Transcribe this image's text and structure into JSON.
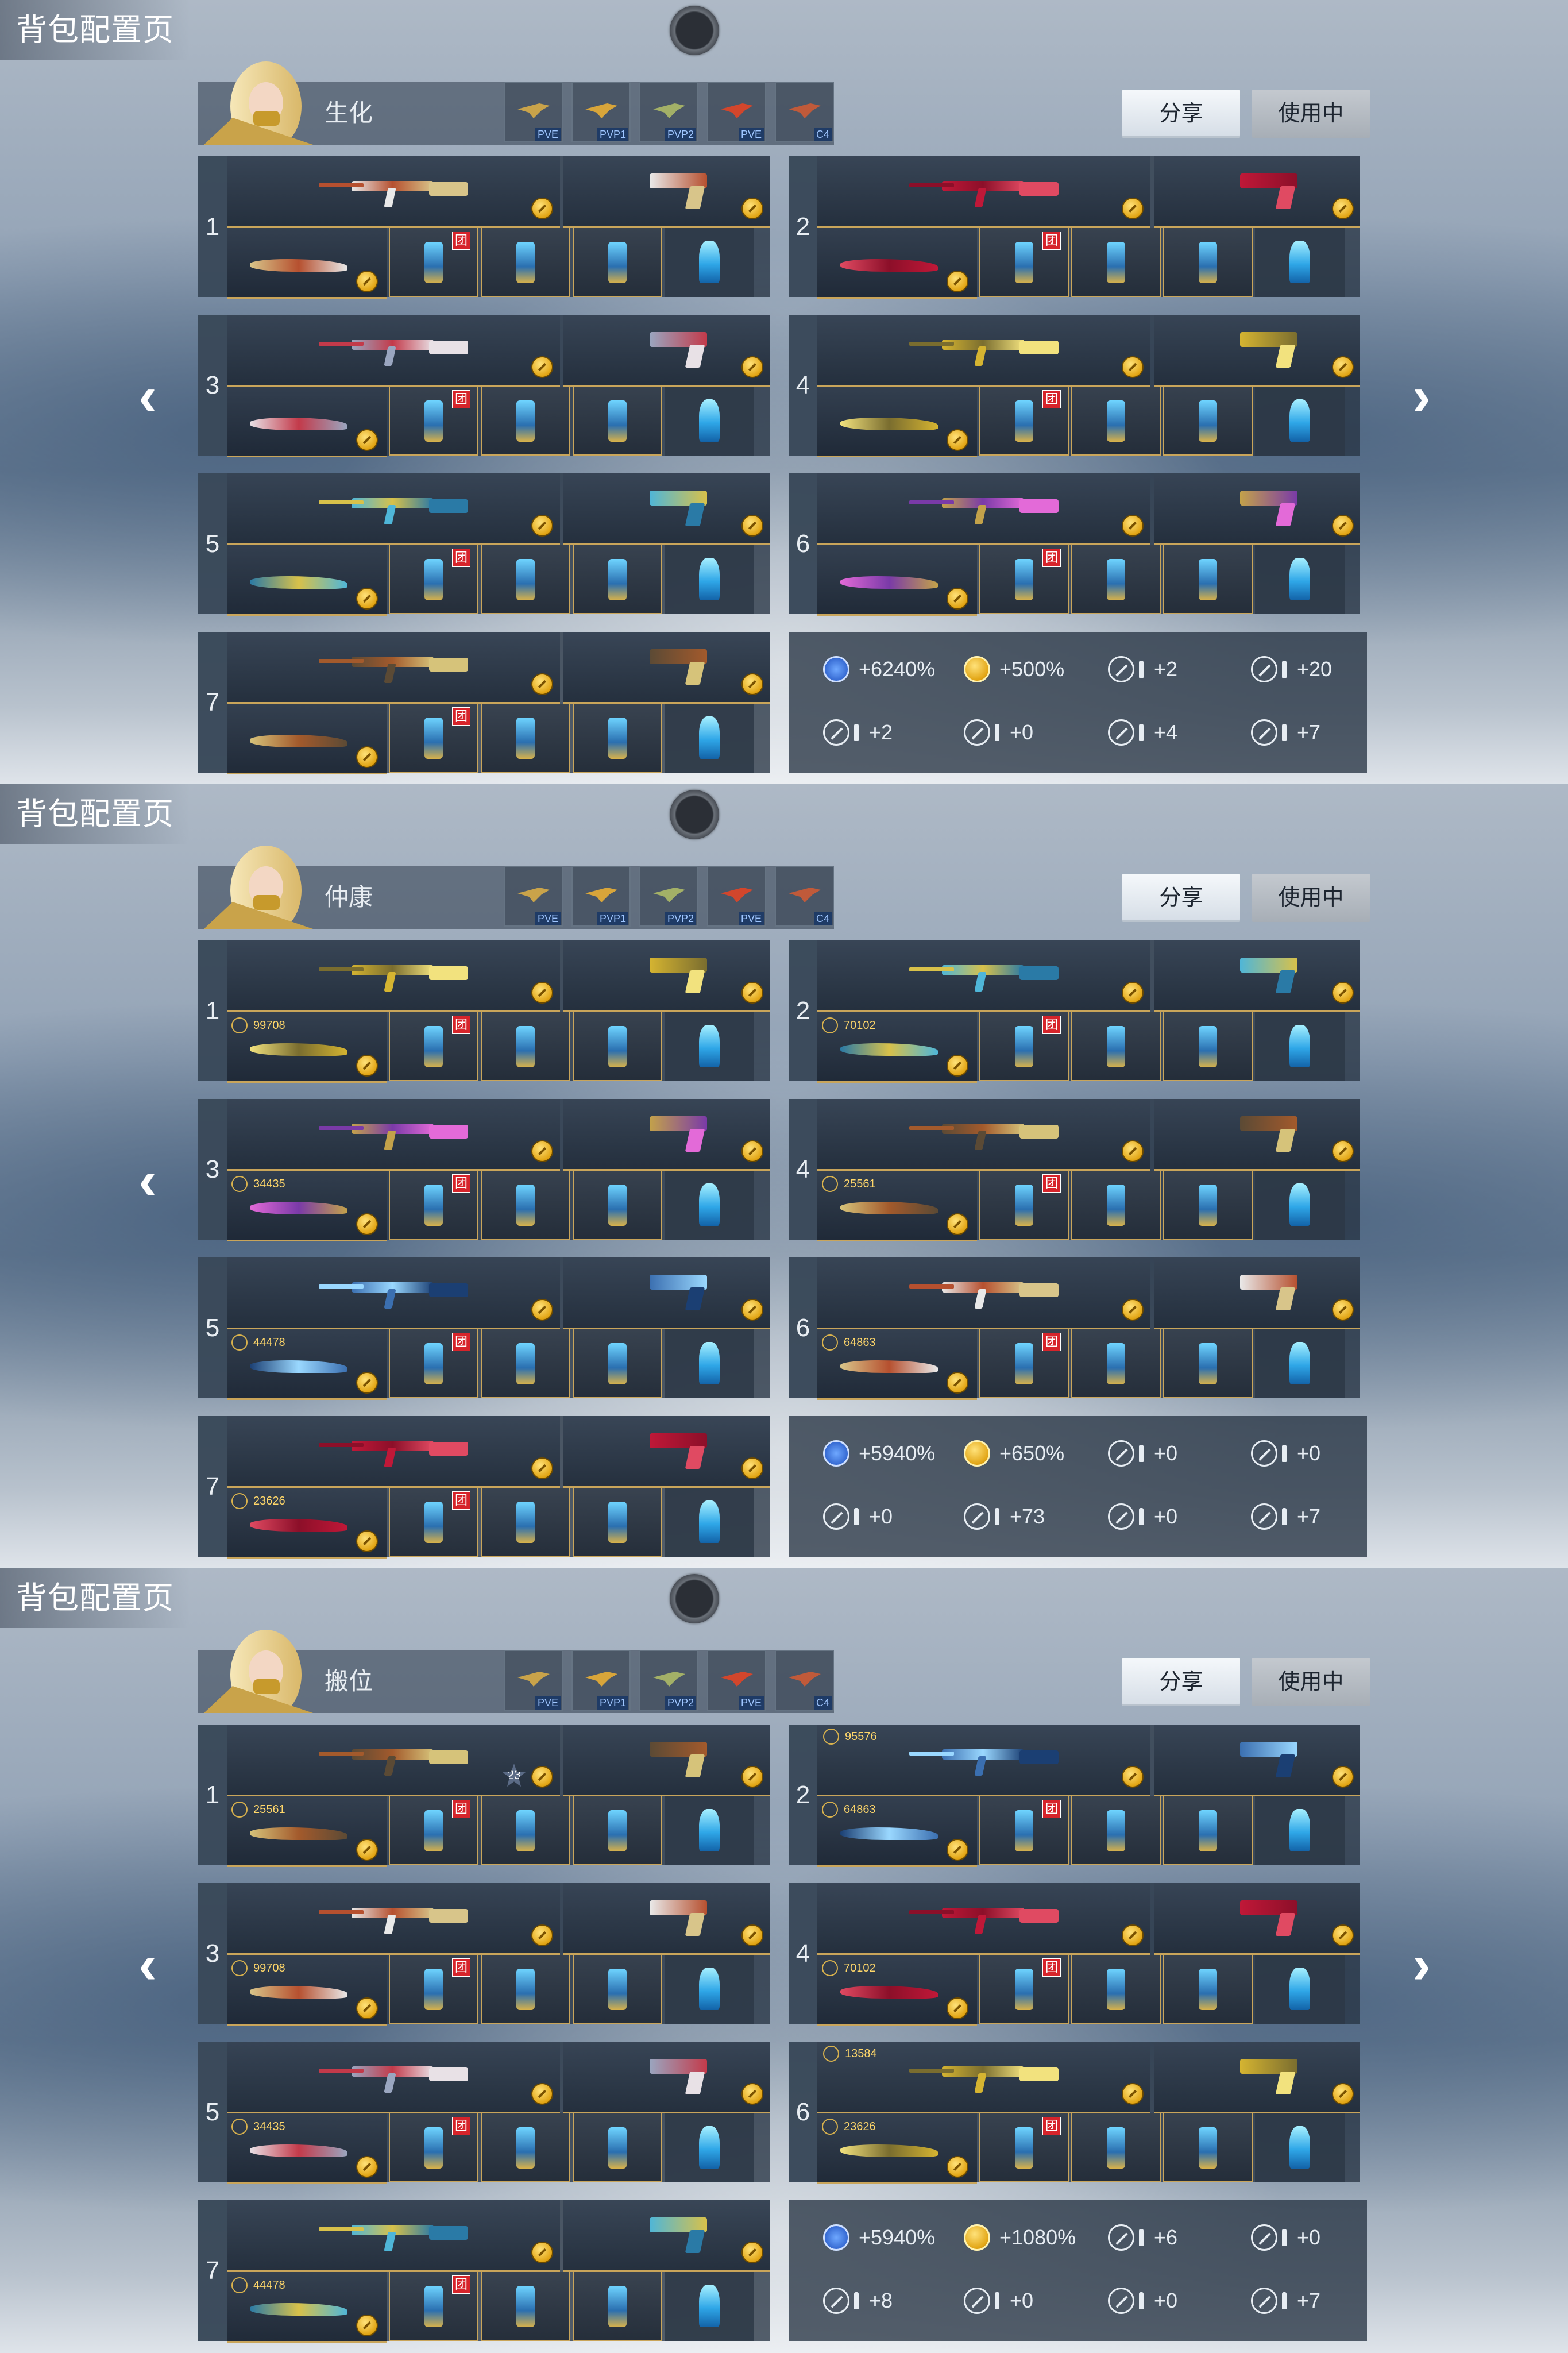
{
  "sections": [
    {
      "title": "背包配置页",
      "mode_name": "生化",
      "tabs": [
        "PVE",
        "PVP1",
        "PVP2",
        "PVE",
        "C4"
      ],
      "share_label": "分享",
      "in_use_label": "使用中",
      "slot_numbers": [
        "1",
        "2",
        "3",
        "4",
        "5",
        "6",
        "7"
      ],
      "kills": {},
      "stats": [
        "+6240%",
        "+500%",
        "+2",
        "+20",
        "+2",
        "+0",
        "+4",
        "+7"
      ]
    },
    {
      "title": "背包配置页",
      "mode_name": "仲康",
      "tabs": [
        "PVE",
        "PVP1",
        "PVP2",
        "PVE",
        "C4"
      ],
      "share_label": "分享",
      "in_use_label": "使用中",
      "slot_numbers": [
        "1",
        "2",
        "3",
        "4",
        "5",
        "6",
        "7"
      ],
      "kills": {
        "1": "99708",
        "2": "70102",
        "3": "34435",
        "4": "25561",
        "5": "44478",
        "6": "64863",
        "7": "23626"
      },
      "stats": [
        "+5940%",
        "+650%",
        "+0",
        "+0",
        "+0",
        "+73",
        "+0",
        "+7"
      ]
    },
    {
      "title": "背包配置页",
      "mode_name": "搬位",
      "tabs": [
        "PVE",
        "PVP1",
        "PVP2",
        "PVE",
        "C4"
      ],
      "share_label": "分享",
      "in_use_label": "使用中",
      "slot_numbers": [
        "1",
        "2",
        "3",
        "4",
        "5",
        "6",
        "7"
      ],
      "kills": {
        "1": "25561",
        "2": "64863",
        "3": "99708",
        "4": "70102",
        "5": "34435",
        "6": "23626",
        "7": "44478"
      },
      "primary_kills": {
        "2": "95576",
        "6": "13584"
      },
      "rank_badge": "23",
      "stats": [
        "+5940%",
        "+1080%",
        "+6",
        "+0",
        "+8",
        "+0",
        "+0",
        "+7"
      ]
    }
  ],
  "team_tag": "团",
  "icons": {
    "nav_left": "chevron-left-icon",
    "nav_right": "chevron-right-icon",
    "record": "record-button-icon",
    "coin": "coin-icon",
    "exp": "exp-icon"
  },
  "colors": {
    "frame_gold": "#c9a55a",
    "team_red": "#d6242b",
    "panel_dark": "#28344a",
    "button_light": "#e9eef3"
  }
}
